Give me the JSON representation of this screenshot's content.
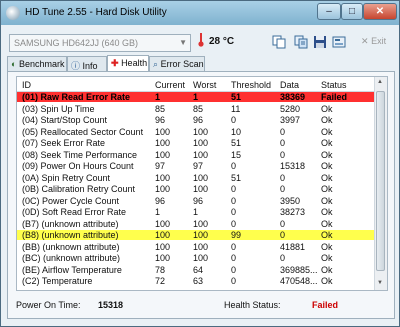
{
  "window": {
    "title": "HD Tune 2.55 - Hard Disk Utility"
  },
  "toolbar": {
    "drive": "SAMSUNG HD642JJ (640 GB)",
    "temperature": "28 °C",
    "exit_label": "Exit",
    "icons": [
      "copy-icon",
      "copy-all-icon",
      "save-icon",
      "options-icon"
    ]
  },
  "tabs": [
    {
      "label": "Benchmark"
    },
    {
      "label": "Info"
    },
    {
      "label": "Health",
      "active": true
    },
    {
      "label": "Error Scan"
    }
  ],
  "table": {
    "headers": [
      "ID",
      "Current",
      "Worst",
      "Threshold",
      "Data",
      "Status"
    ],
    "rows": [
      {
        "id": "(01) Raw Read Error Rate",
        "current": "1",
        "worst": "1",
        "threshold": "51",
        "data": "38369",
        "status": "Failed",
        "highlight": "red"
      },
      {
        "id": "(03) Spin Up Time",
        "current": "85",
        "worst": "85",
        "threshold": "11",
        "data": "5280",
        "status": "Ok"
      },
      {
        "id": "(04) Start/Stop Count",
        "current": "96",
        "worst": "96",
        "threshold": "0",
        "data": "3997",
        "status": "Ok"
      },
      {
        "id": "(05) Reallocated Sector Count",
        "current": "100",
        "worst": "100",
        "threshold": "10",
        "data": "0",
        "status": "Ok"
      },
      {
        "id": "(07) Seek Error Rate",
        "current": "100",
        "worst": "100",
        "threshold": "51",
        "data": "0",
        "status": "Ok"
      },
      {
        "id": "(08) Seek Time Performance",
        "current": "100",
        "worst": "100",
        "threshold": "15",
        "data": "0",
        "status": "Ok"
      },
      {
        "id": "(09) Power On Hours Count",
        "current": "97",
        "worst": "97",
        "threshold": "0",
        "data": "15318",
        "status": "Ok"
      },
      {
        "id": "(0A) Spin Retry Count",
        "current": "100",
        "worst": "100",
        "threshold": "51",
        "data": "0",
        "status": "Ok"
      },
      {
        "id": "(0B) Calibration Retry Count",
        "current": "100",
        "worst": "100",
        "threshold": "0",
        "data": "0",
        "status": "Ok"
      },
      {
        "id": "(0C) Power Cycle Count",
        "current": "96",
        "worst": "96",
        "threshold": "0",
        "data": "3950",
        "status": "Ok"
      },
      {
        "id": "(0D) Soft Read Error Rate",
        "current": "1",
        "worst": "1",
        "threshold": "0",
        "data": "38273",
        "status": "Ok"
      },
      {
        "id": "(B7) (unknown attribute)",
        "current": "100",
        "worst": "100",
        "threshold": "0",
        "data": "0",
        "status": "Ok"
      },
      {
        "id": "(B8) (unknown attribute)",
        "current": "100",
        "worst": "100",
        "threshold": "99",
        "data": "0",
        "status": "Ok",
        "highlight": "yellow"
      },
      {
        "id": "(BB) (unknown attribute)",
        "current": "100",
        "worst": "100",
        "threshold": "0",
        "data": "41881",
        "status": "Ok"
      },
      {
        "id": "(BC) (unknown attribute)",
        "current": "100",
        "worst": "100",
        "threshold": "0",
        "data": "0",
        "status": "Ok"
      },
      {
        "id": "(BE) Airflow Temperature",
        "current": "78",
        "worst": "64",
        "threshold": "0",
        "data": "369885...",
        "status": "Ok"
      },
      {
        "id": "(C2) Temperature",
        "current": "72",
        "worst": "63",
        "threshold": "0",
        "data": "470548...",
        "status": "Ok"
      }
    ]
  },
  "footer": {
    "power_on_label": "Power On Time:",
    "power_on_value": "15318",
    "health_label": "Health Status:",
    "health_value": "Failed"
  },
  "colors": {
    "failed": "#ff3030",
    "warning": "#ffff4d",
    "failed_text": "#cc0000"
  }
}
